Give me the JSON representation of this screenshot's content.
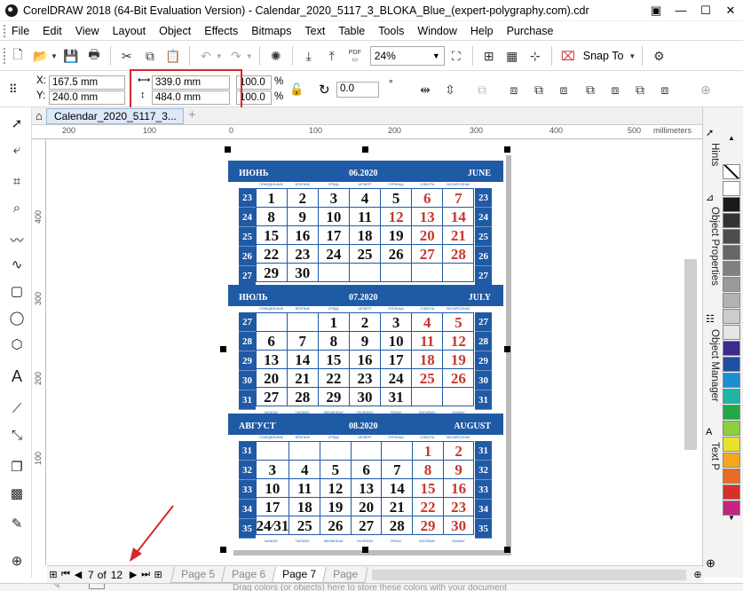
{
  "window": {
    "title": "CorelDRAW 2018 (64-Bit Evaluation Version) - Calendar_2020_5117_3_BLOKA_Blue_(expert-polygraphy.com).cdr"
  },
  "menu": [
    "File",
    "Edit",
    "View",
    "Layout",
    "Object",
    "Effects",
    "Bitmaps",
    "Text",
    "Table",
    "Tools",
    "Window",
    "Help",
    "Purchase"
  ],
  "toolbar": {
    "zoom": "24%",
    "snap_label": "Snap To",
    "pdf_label": "PDF"
  },
  "props": {
    "x": "167.5 mm",
    "y": "240.0 mm",
    "x_label": "X:",
    "y_label": "Y:",
    "width": "339.0 mm",
    "height": "484.0 mm",
    "scale_w": "100.0",
    "scale_h": "100.0",
    "pct": "%",
    "rotation": "0.0",
    "deg": "°"
  },
  "tab": {
    "name": "Calendar_2020_5117_3..."
  },
  "ruler": {
    "h_ticks": [
      "200",
      "100",
      "0",
      "100",
      "200",
      "300",
      "400",
      "500"
    ],
    "unit": "millimeters",
    "v_ticks": [
      "400",
      "300",
      "200",
      "100"
    ]
  },
  "docker": {
    "tabs": [
      "Hints",
      "Object Properties",
      "Object Manager",
      "Text P"
    ]
  },
  "palette": {
    "colors": [
      "#ffffff",
      "#1a1a1a",
      "#333333",
      "#4d4d4d",
      "#666666",
      "#808080",
      "#999999",
      "#b3b3b3",
      "#cccccc",
      "#e6e6e6",
      "#3d2a8f",
      "#1f4fa0",
      "#1a8fd1",
      "#1fb6a6",
      "#21a84a",
      "#8ccf3f",
      "#e9e22a",
      "#f5a623",
      "#e96b24",
      "#d6302a",
      "#c4257e"
    ]
  },
  "pagenav": {
    "current": "7",
    "of": "of",
    "total": "12",
    "tabs": [
      "Page 5",
      "Page 6",
      "Page 7",
      "Page"
    ]
  },
  "status": {
    "hint": "Drag colors (or objects) here to store these colors with your document"
  },
  "calendar": {
    "dow_ru": [
      "ПОНЕДЕЛЬНИК",
      "ВТОРНИК",
      "СРЕДА",
      "ЧЕТВЕРГ",
      "ПЯТНИЦА",
      "СУББОТА",
      "ВОСКРЕСЕНЬЕ"
    ],
    "dow_en": [
      "MONDAY",
      "TUESDAY",
      "WEDNESDAY",
      "THURSDAY",
      "FRIDAY",
      "SATURDAY",
      "SUNDAY"
    ],
    "months": [
      {
        "ru": "ИЮНЬ",
        "code": "06.2020",
        "en": "JUNE",
        "weeks": [
          "23",
          "24",
          "25",
          "26",
          "27"
        ],
        "rows": [
          [
            "1",
            "2",
            "3",
            "4",
            "5",
            "6",
            "7"
          ],
          [
            "8",
            "9",
            "10",
            "11",
            "12",
            "13",
            "14"
          ],
          [
            "15",
            "16",
            "17",
            "18",
            "19",
            "20",
            "21"
          ],
          [
            "22",
            "23",
            "24",
            "25",
            "26",
            "27",
            "28"
          ],
          [
            "29",
            "30",
            "",
            "",
            "",
            "",
            ""
          ]
        ],
        "red": [
          [
            0,
            5
          ],
          [
            0,
            6
          ],
          [
            1,
            4
          ],
          [
            1,
            5
          ],
          [
            1,
            6
          ],
          [
            2,
            5
          ],
          [
            2,
            6
          ],
          [
            3,
            5
          ],
          [
            3,
            6
          ]
        ]
      },
      {
        "ru": "ИЮЛЬ",
        "code": "07.2020",
        "en": "JULY",
        "weeks": [
          "27",
          "28",
          "29",
          "30",
          "31"
        ],
        "rows": [
          [
            "",
            "",
            "1",
            "2",
            "3",
            "4",
            "5"
          ],
          [
            "6",
            "7",
            "8",
            "9",
            "10",
            "11",
            "12"
          ],
          [
            "13",
            "14",
            "15",
            "16",
            "17",
            "18",
            "19"
          ],
          [
            "20",
            "21",
            "22",
            "23",
            "24",
            "25",
            "26"
          ],
          [
            "27",
            "28",
            "29",
            "30",
            "31",
            "",
            ""
          ]
        ],
        "red": [
          [
            0,
            5
          ],
          [
            0,
            6
          ],
          [
            1,
            5
          ],
          [
            1,
            6
          ],
          [
            2,
            5
          ],
          [
            2,
            6
          ],
          [
            3,
            5
          ],
          [
            3,
            6
          ]
        ]
      },
      {
        "ru": "АВГУСТ",
        "code": "08.2020",
        "en": "AUGUST",
        "weeks": [
          "31",
          "32",
          "33",
          "34",
          "35"
        ],
        "rows": [
          [
            "",
            "",
            "",
            "",
            "",
            "1",
            "2"
          ],
          [
            "3",
            "4",
            "5",
            "6",
            "7",
            "8",
            "9"
          ],
          [
            "10",
            "11",
            "12",
            "13",
            "14",
            "15",
            "16"
          ],
          [
            "17",
            "18",
            "19",
            "20",
            "21",
            "22",
            "23"
          ],
          [
            "24⁄31",
            "25",
            "26",
            "27",
            "28",
            "29",
            "30"
          ]
        ],
        "red": [
          [
            0,
            5
          ],
          [
            0,
            6
          ],
          [
            1,
            5
          ],
          [
            1,
            6
          ],
          [
            2,
            5
          ],
          [
            2,
            6
          ],
          [
            3,
            5
          ],
          [
            3,
            6
          ],
          [
            4,
            5
          ],
          [
            4,
            6
          ]
        ]
      }
    ]
  }
}
